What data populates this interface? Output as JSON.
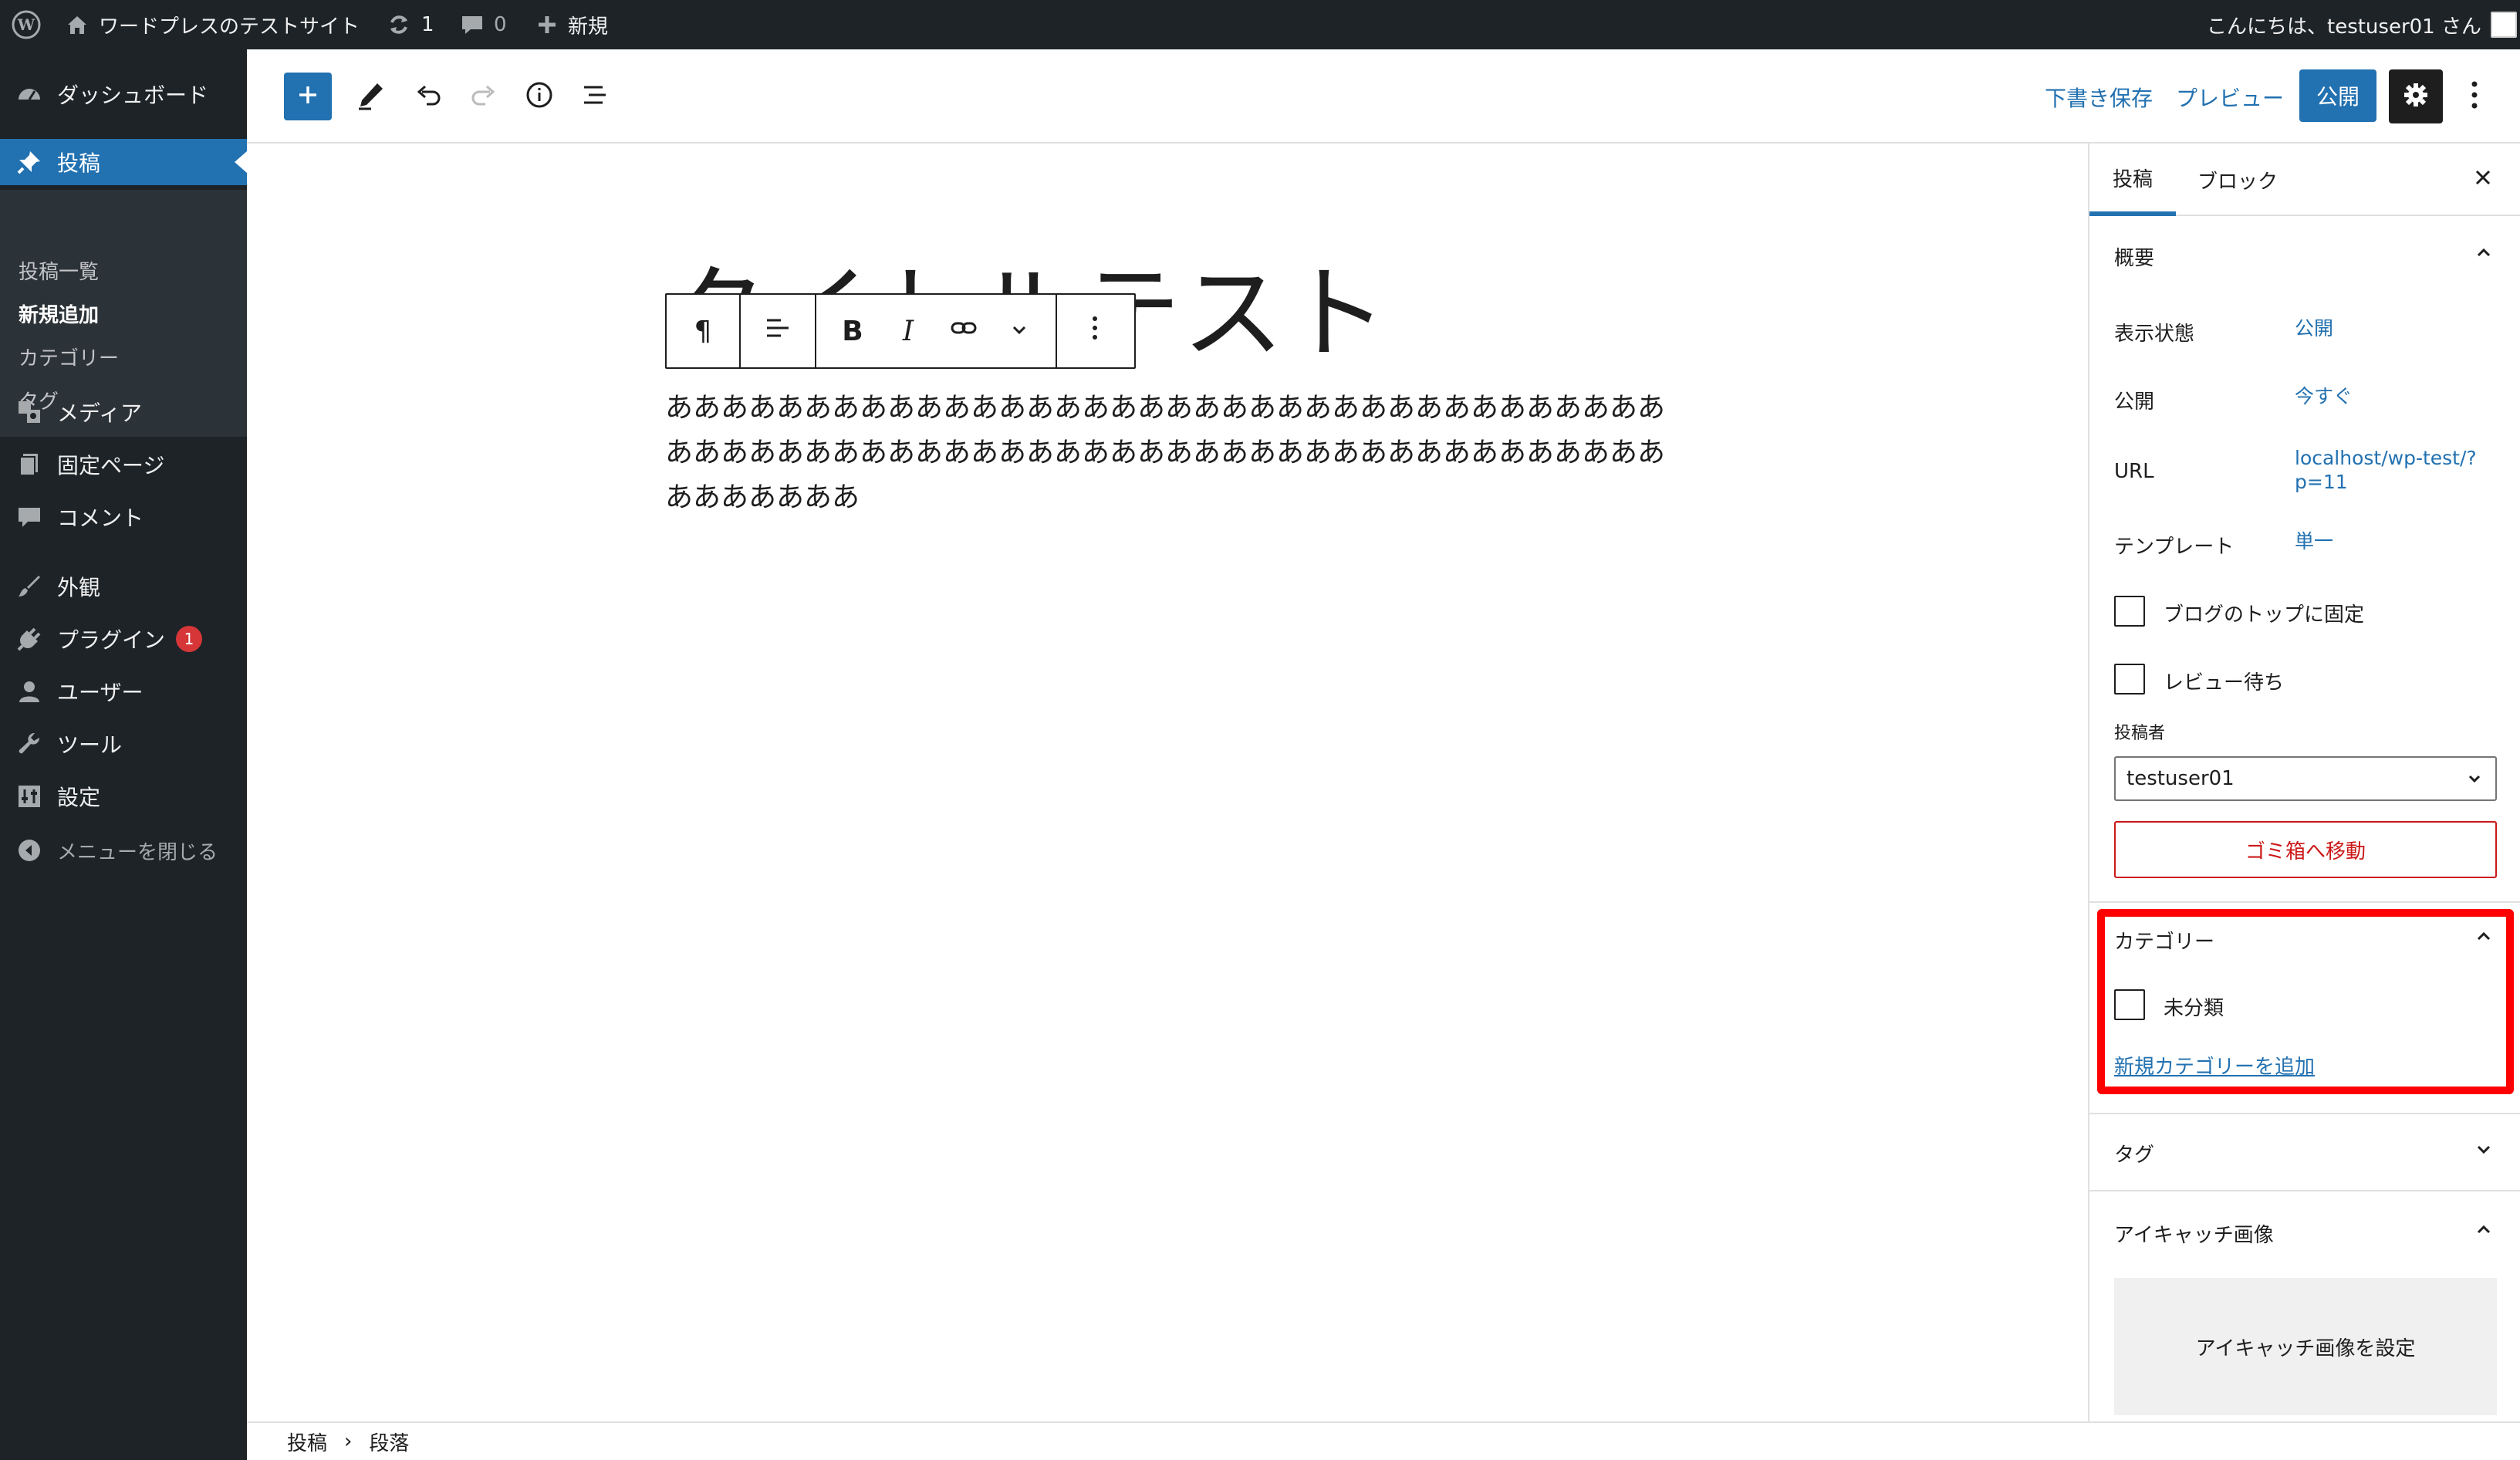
{
  "adminbar": {
    "site_name": "ワードプレスのテストサイト",
    "updates_count": "1",
    "comments_count": "0",
    "new_label": "新規",
    "greeting": "こんにちは、testuser01 さん"
  },
  "adminmenu": {
    "dashboard": "ダッシュボード",
    "posts": "投稿",
    "sub_all_posts": "投稿一覧",
    "sub_add_new": "新規追加",
    "sub_categories": "カテゴリー",
    "sub_tags": "タグ",
    "media": "メディア",
    "pages": "固定ページ",
    "comments": "コメント",
    "appearance": "外観",
    "plugins": "プラグイン",
    "plugins_badge": "1",
    "users": "ユーザー",
    "tools": "ツール",
    "settings": "設定",
    "collapse": "メニューを閉じる"
  },
  "header": {
    "save_draft": "下書き保存",
    "preview": "プレビュー",
    "publish": "公開"
  },
  "editor": {
    "title": "タイトルテスト",
    "paragraph": "あああああああああああああああああああああああああああああああああああああああああああああああああああああああああああああああああああああああああああああああ",
    "block_toolbar": {
      "paragraph_symbol": "¶",
      "bold": "B",
      "italic": "I"
    }
  },
  "sidebar": {
    "tab_post": "投稿",
    "tab_block": "ブロック",
    "summary": {
      "heading": "概要",
      "visibility_label": "表示状態",
      "visibility_value": "公開",
      "publish_label": "公開",
      "publish_value": "今すぐ",
      "url_label": "URL",
      "url_value_line1": "localhost/wp-test/?",
      "url_value_line2": "p=11",
      "template_label": "テンプレート",
      "template_value": "単一",
      "sticky_label": "ブログのトップに固定",
      "pending_label": "レビュー待ち",
      "author_label": "投稿者",
      "author_value": "testuser01",
      "trash_button": "ゴミ箱へ移動"
    },
    "categories": {
      "heading": "カテゴリー",
      "item": "未分類",
      "add_new": "新規カテゴリーを追加"
    },
    "tags": {
      "heading": "タグ"
    },
    "featured": {
      "heading": "アイキャッチ画像",
      "set_button": "アイキャッチ画像を設定"
    }
  },
  "footer": {
    "crumb1": "投稿",
    "separator": "›",
    "crumb2": "段落"
  }
}
